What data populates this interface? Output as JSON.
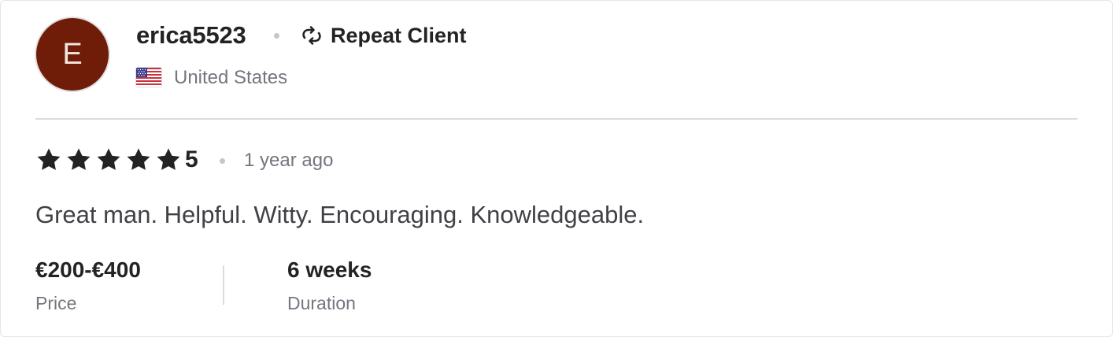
{
  "review": {
    "avatar_initial": "E",
    "avatar_color": "#6f1d08",
    "username": "erica5523",
    "badge": {
      "icon": "repeat-icon",
      "label": "Repeat Client"
    },
    "country": {
      "flag_icon": "us-flag-icon",
      "name": "United States"
    },
    "rating": {
      "stars": 5,
      "value": "5",
      "star_color": "#222325"
    },
    "time_ago": "1 year ago",
    "text": "Great man. Helpful. Witty. Encouraging. Knowledgeable.",
    "price": {
      "value": "€200-€400",
      "label": "Price"
    },
    "duration": {
      "value": "6 weeks",
      "label": "Duration"
    }
  }
}
